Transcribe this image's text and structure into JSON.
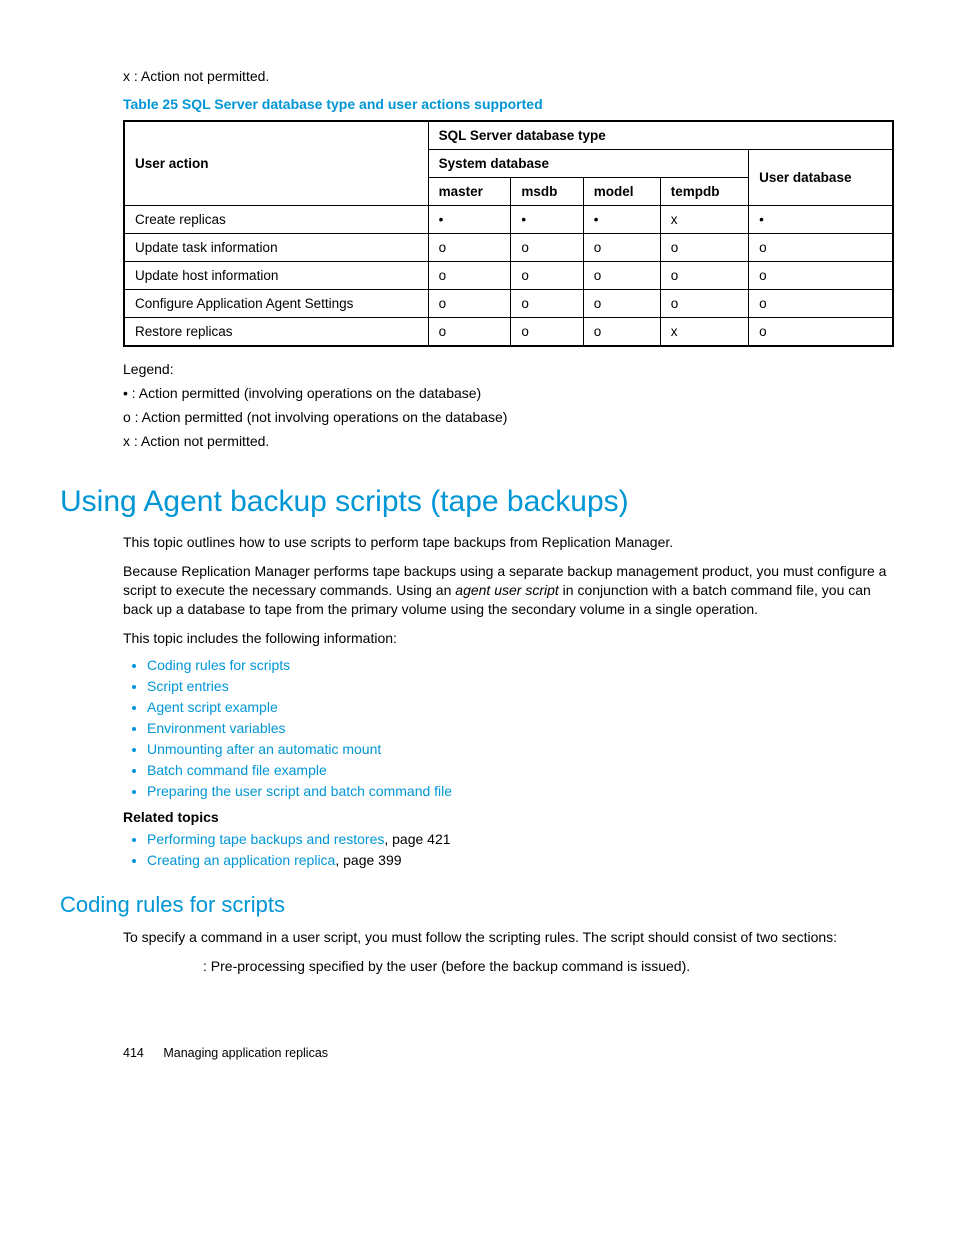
{
  "top_note": "x : Action not permitted.",
  "table_title": "Table 25 SQL Server database type and user actions supported",
  "table": {
    "headers": {
      "user_action": "User action",
      "sql_type": "SQL Server database type",
      "system_db": "System database",
      "user_db": "User database",
      "cols": [
        "master",
        "msdb",
        "model",
        "tempdb"
      ]
    },
    "rows": [
      {
        "label": "Create replicas",
        "cells": [
          "•",
          "•",
          "•",
          "x",
          "•"
        ]
      },
      {
        "label": "Update task information",
        "cells": [
          "o",
          "o",
          "o",
          "o",
          "o"
        ]
      },
      {
        "label": "Update host information",
        "cells": [
          "o",
          "o",
          "o",
          "o",
          "o"
        ]
      },
      {
        "label": "Configure Application Agent Settings",
        "cells": [
          "o",
          "o",
          "o",
          "o",
          "o"
        ]
      },
      {
        "label": "Restore replicas",
        "cells": [
          "o",
          "o",
          "o",
          "x",
          "o"
        ]
      }
    ]
  },
  "legend": {
    "title": "Legend:",
    "items": [
      "• : Action permitted (involving operations on the database)",
      "o : Action permitted (not involving operations on the database)",
      "x : Action not permitted."
    ]
  },
  "h1": "Using Agent backup scripts (tape backups)",
  "p1": "This topic outlines how to use scripts to perform tape backups from Replication Manager.",
  "p2a": "Because Replication Manager performs tape backups using a separate backup management product, you must configure a script to execute the necessary commands. Using an ",
  "p2_italic": "agent user script",
  "p2b": " in conjunction with a batch command file, you can back up a database to tape from the primary volume using the secondary volume in a single operation.",
  "p3": "This topic includes the following information:",
  "topic_links": [
    "Coding rules for scripts",
    "Script entries",
    "Agent script example",
    "Environment variables",
    "Unmounting after an automatic mount",
    "Batch command file example",
    "Preparing the user script and batch command file"
  ],
  "related_title": "Related topics",
  "related": [
    {
      "link": "Performing tape backups and restores",
      "suffix": ", page 421"
    },
    {
      "link": "Creating an application replica",
      "suffix": ", page 399"
    }
  ],
  "h2": "Coding rules for scripts",
  "p4": "To specify a command in a user script, you must follow the scripting rules. The script should consist of two sections:",
  "pre_entry": ": Pre-processing specified by the user (before the backup command is issued).",
  "footer": {
    "page": "414",
    "title": "Managing application replicas"
  }
}
